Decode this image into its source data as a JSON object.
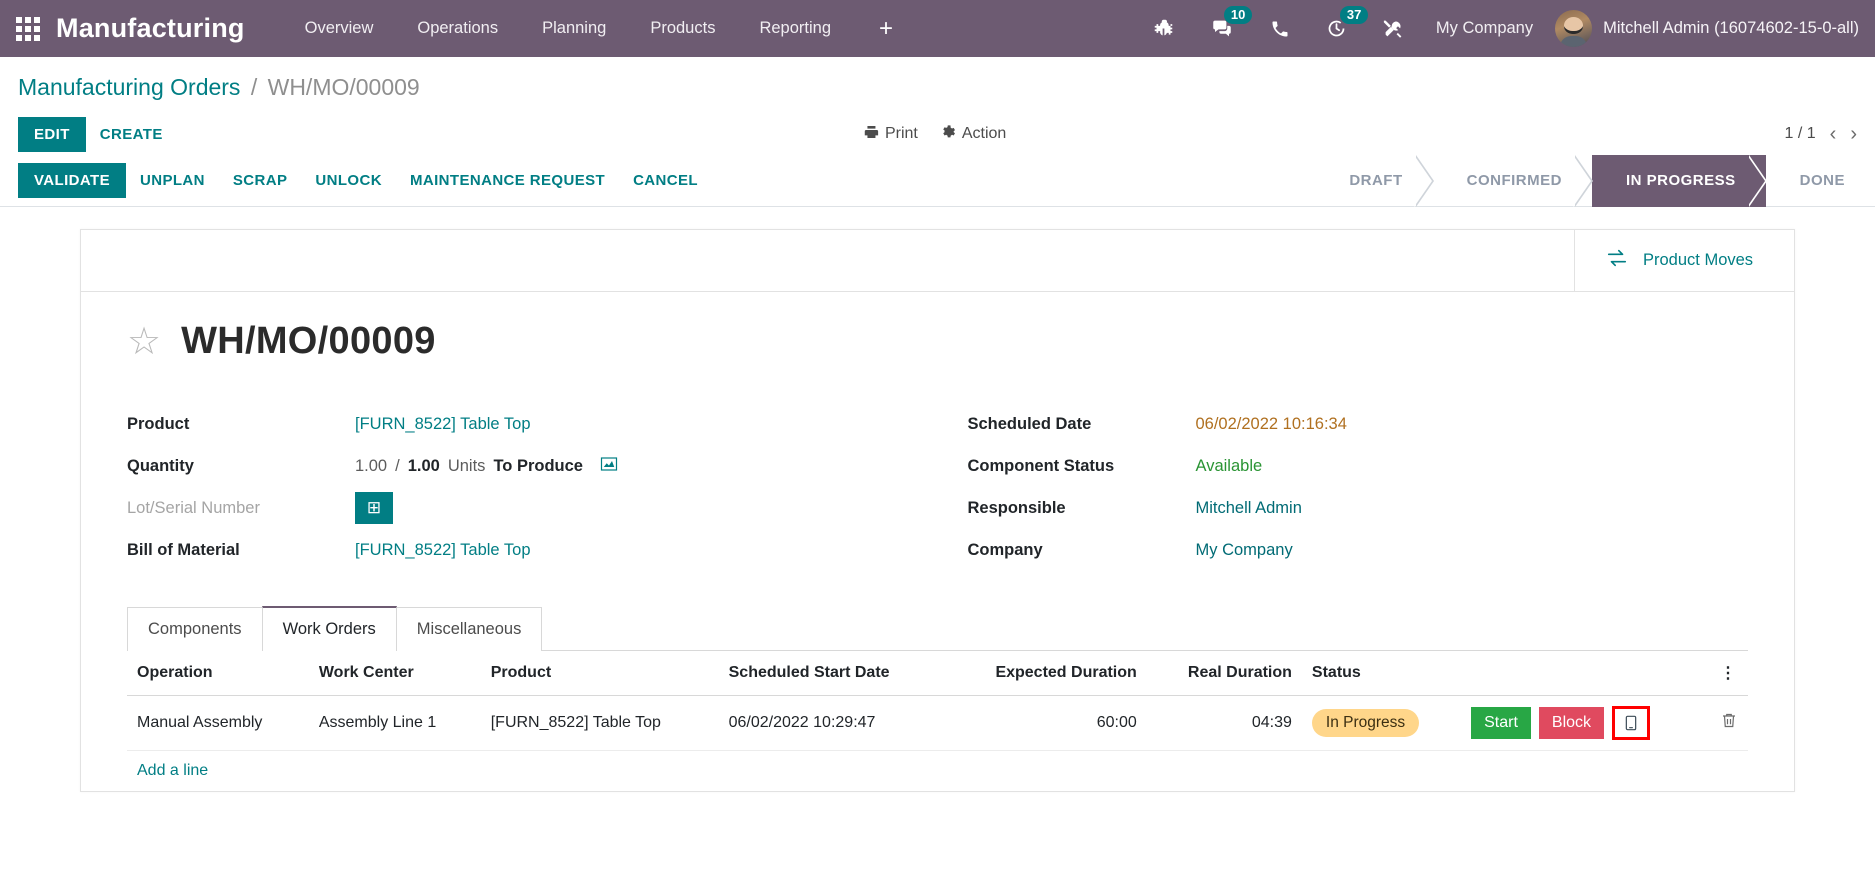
{
  "navbar": {
    "apps_icon": "apps-grid-icon",
    "brand": "Manufacturing",
    "menus": [
      "Overview",
      "Operations",
      "Planning",
      "Products",
      "Reporting"
    ],
    "plus_label": "+",
    "icons": [
      {
        "name": "bug-icon",
        "badge": null
      },
      {
        "name": "messages-icon",
        "badge": "10"
      },
      {
        "name": "phone-icon",
        "badge": null
      },
      {
        "name": "activity-clock-icon",
        "badge": "37"
      },
      {
        "name": "tools-icon",
        "badge": null
      }
    ],
    "company": "My Company",
    "user": "Mitchell Admin (16074602-15-0-all)"
  },
  "breadcrumb": {
    "root": "Manufacturing Orders",
    "separator": "/",
    "current": "WH/MO/00009"
  },
  "control_panel": {
    "edit": "EDIT",
    "create": "CREATE",
    "print": "Print",
    "print_icon": "printer-icon",
    "action": "Action",
    "action_icon": "gear-icon",
    "pager": "1 / 1",
    "prev_icon": "chevron-left-icon",
    "next_icon": "chevron-right-icon",
    "buttons": [
      "VALIDATE",
      "UNPLAN",
      "SCRAP",
      "UNLOCK",
      "MAINTENANCE REQUEST",
      "CANCEL"
    ],
    "statuses": [
      "DRAFT",
      "CONFIRMED",
      "IN PROGRESS",
      "DONE"
    ],
    "active_status": "IN PROGRESS"
  },
  "stat_button": {
    "label": "Product Moves",
    "icon": "exchange-arrows-icon"
  },
  "record": {
    "star_icon": "star-outline-icon",
    "title": "WH/MO/00009"
  },
  "form": {
    "left": [
      {
        "label": "Product",
        "value": "[FURN_8522] Table Top",
        "style": "link"
      },
      {
        "label": "Quantity",
        "value": "1.00",
        "value2": "1.00",
        "sep": "/",
        "unit": "Units",
        "suffix": "To Produce",
        "style": "quantity",
        "icon": "bar-chart-icon"
      },
      {
        "label": "Lot/Serial Number",
        "value": "",
        "style": "button",
        "button_icon": "add-box-icon"
      },
      {
        "label": "Bill of Material",
        "value": "[FURN_8522] Table Top",
        "style": "link"
      }
    ],
    "right": [
      {
        "label": "Scheduled Date",
        "value": "06/02/2022 10:16:34",
        "style": "orange"
      },
      {
        "label": "Component Status",
        "value": "Available",
        "style": "green"
      },
      {
        "label": "Responsible",
        "value": "Mitchell Admin",
        "style": "link"
      },
      {
        "label": "Company",
        "value": "My Company",
        "style": "link"
      }
    ]
  },
  "notebook": {
    "tabs": [
      "Components",
      "Work Orders",
      "Miscellaneous"
    ],
    "active_tab": "Work Orders"
  },
  "work_orders": {
    "columns": [
      "Operation",
      "Work Center",
      "Product",
      "Scheduled Start Date",
      "Expected Duration",
      "Real Duration",
      "Status"
    ],
    "options_icon": "vertical-dots-icon",
    "rows": [
      {
        "operation": "Manual Assembly",
        "work_center": "Assembly Line 1",
        "product": "[FURN_8522] Table Top",
        "scheduled_start_date": "06/02/2022 10:29:47",
        "expected_duration": "60:00",
        "real_duration": "04:39",
        "status": "In Progress",
        "start_label": "Start",
        "block_label": "Block",
        "tablet_icon": "tablet-icon",
        "delete_icon": "trash-icon"
      }
    ],
    "add_line": "Add a line"
  },
  "colors": {
    "navbar_bg": "#6d5b72",
    "primary": "#017e84",
    "active_stage": "#6d5b72",
    "start_green": "#28a745",
    "block_red": "#e04a5f",
    "badge_yellow": "#ffd68a",
    "highlight_red": "#ff0000",
    "orange_value": "#b07020",
    "green_value": "#2a9434"
  }
}
